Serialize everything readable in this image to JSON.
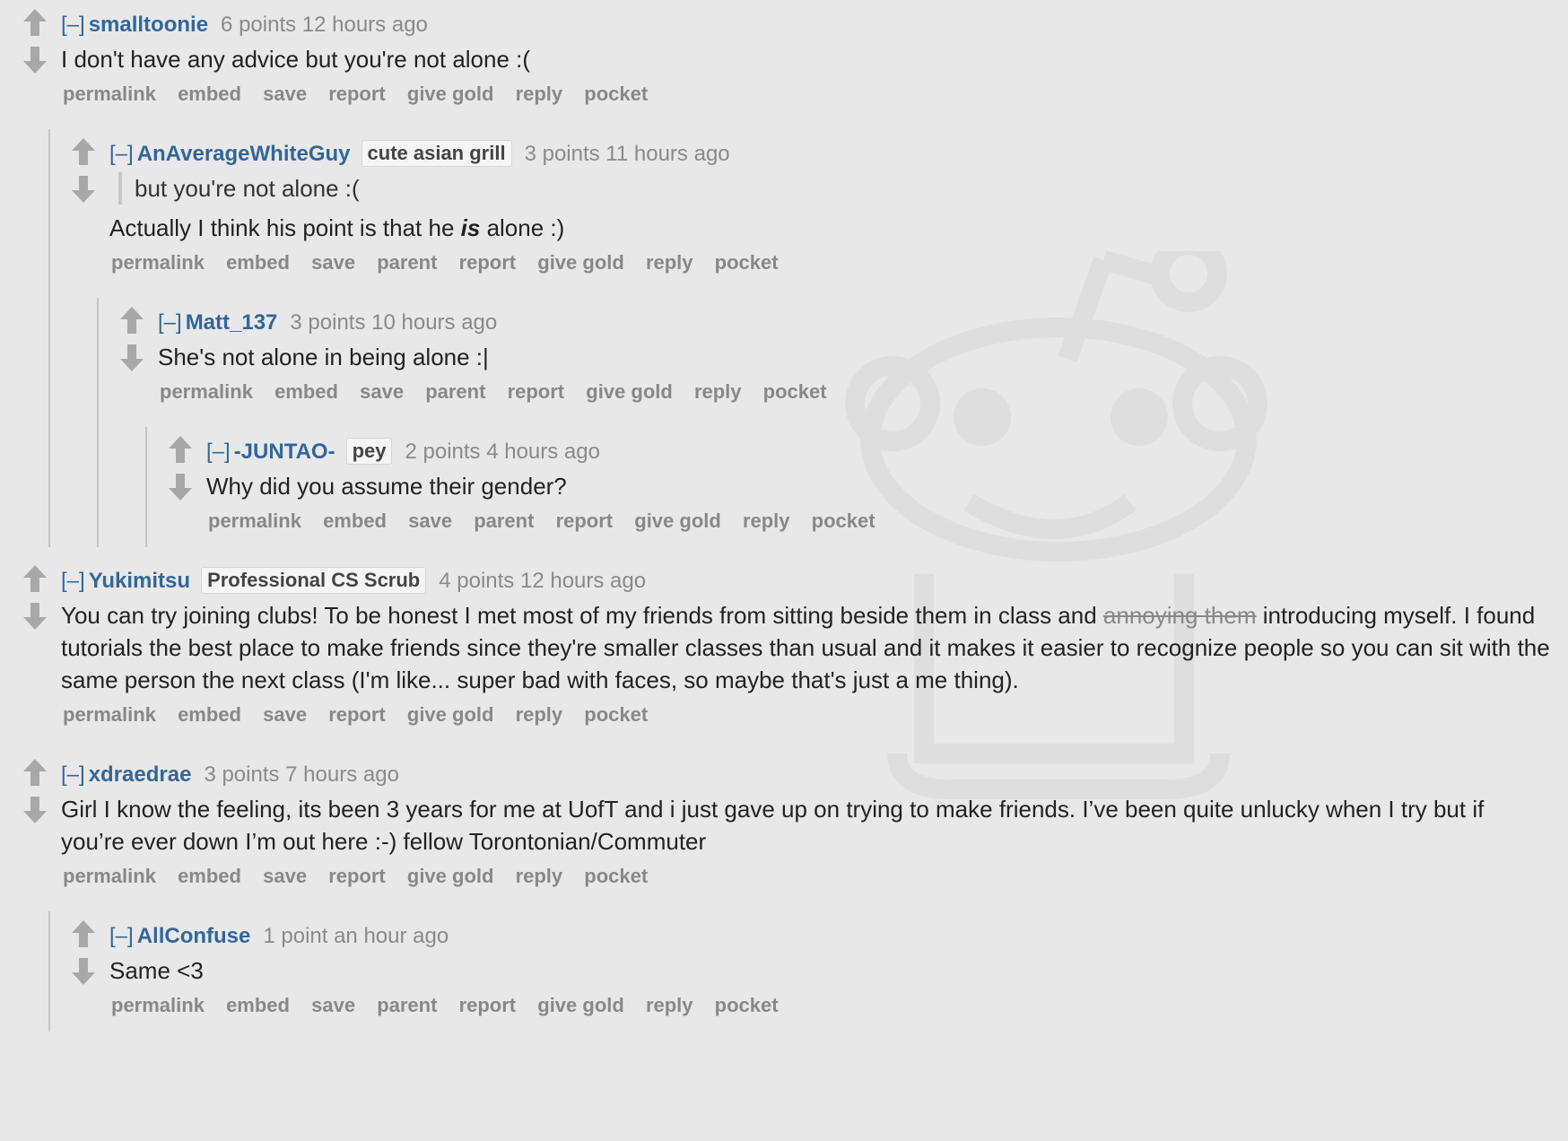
{
  "colors": {
    "background": "#e8e8e8",
    "link": "#336699",
    "meta": "#8a8a8a",
    "buttons": "#888888",
    "arrow": "#a8a8a8"
  },
  "icons": {
    "upvote": "up-arrow-icon",
    "downvote": "down-arrow-icon",
    "watermark": "reddit-alien-watermark"
  },
  "expand_label": "[–]",
  "comments": [
    {
      "author": "smalltoonie",
      "flair": "",
      "meta": "6 points 12 hours ago",
      "body": [
        "I don't have any advice but you're not alone :("
      ],
      "buttons": [
        "permalink",
        "embed",
        "save",
        "report",
        "give gold",
        "reply",
        "pocket"
      ]
    },
    {
      "author": "AnAverageWhiteGuy",
      "flair": "cute asian grill",
      "meta": "3 points 11 hours ago",
      "quote": "but you're not alone :(",
      "body_pre": "Actually I think his point is that he ",
      "body_em": "is",
      "body_post": " alone :)",
      "buttons": [
        "permalink",
        "embed",
        "save",
        "parent",
        "report",
        "give gold",
        "reply",
        "pocket"
      ]
    },
    {
      "author": "Matt_137",
      "flair": "",
      "meta": "3 points 10 hours ago",
      "body": [
        "She's not alone in being alone :|"
      ],
      "buttons": [
        "permalink",
        "embed",
        "save",
        "parent",
        "report",
        "give gold",
        "reply",
        "pocket"
      ]
    },
    {
      "author": "-JUNTAO-",
      "flair": "pey",
      "meta": "2 points 4 hours ago",
      "body": [
        "Why did you assume their gender?"
      ],
      "buttons": [
        "permalink",
        "embed",
        "save",
        "parent",
        "report",
        "give gold",
        "reply",
        "pocket"
      ]
    },
    {
      "author": "Yukimitsu",
      "flair": "Professional CS Scrub",
      "meta": "4 points 12 hours ago",
      "body_pre": "You can try joining clubs! To be honest I met most of my friends from sitting beside them in class and ",
      "body_strike": "annoying them",
      "body_post": " introducing myself. I found tutorials the best place to make friends since they're smaller classes than usual and it makes it easier to recognize people so you can sit with the same person the next class (I'm like... super bad with faces, so maybe that's just a me thing).",
      "buttons": [
        "permalink",
        "embed",
        "save",
        "report",
        "give gold",
        "reply",
        "pocket"
      ]
    },
    {
      "author": "xdraedrae",
      "flair": "",
      "meta": "3 points 7 hours ago",
      "body": [
        "Girl I know the feeling, its been 3 years for me at UofT and i just gave up on trying to make friends. I’ve been quite unlucky when I try but if you’re ever down I’m out here :-) fellow Torontonian/Commuter"
      ],
      "buttons": [
        "permalink",
        "embed",
        "save",
        "report",
        "give gold",
        "reply",
        "pocket"
      ]
    },
    {
      "author": "AllConfuse",
      "flair": "",
      "meta": "1 point an hour ago",
      "body": [
        "Same <3"
      ],
      "buttons": [
        "permalink",
        "embed",
        "save",
        "parent",
        "report",
        "give gold",
        "reply",
        "pocket"
      ]
    }
  ]
}
